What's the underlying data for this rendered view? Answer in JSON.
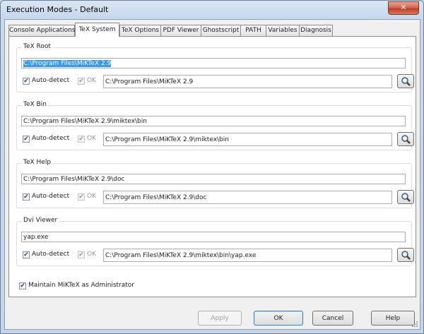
{
  "window": {
    "title": "Execution Modes - Default",
    "close_label": "✕"
  },
  "tabs": [
    {
      "label": "Console Applications"
    },
    {
      "label": "TeX System"
    },
    {
      "label": "TeX Options"
    },
    {
      "label": "PDF Viewer"
    },
    {
      "label": "Ghostscript"
    },
    {
      "label": "PATH"
    },
    {
      "label": "Variables"
    },
    {
      "label": "Diagnosis"
    }
  ],
  "active_tab": "TeX System",
  "groups": [
    {
      "label": "TeX Root",
      "value": "C:\\Program Files\\MiKTeX 2.9",
      "auto_detect_label": "Auto-detect",
      "ok_label": "OK",
      "detected_value": "C:\\Program Files\\MiKTeX 2.9"
    },
    {
      "label": "TeX Bin",
      "value": "C:\\Program Files\\MiKTeX 2.9\\miktex\\bin",
      "auto_detect_label": "Auto-detect",
      "ok_label": "OK",
      "detected_value": "C:\\Program Files\\MiKTeX 2.9\\miktex\\bin"
    },
    {
      "label": "TeX Help",
      "value": "C:\\Program Files\\MiKTeX 2.9\\doc",
      "auto_detect_label": "Auto-detect",
      "ok_label": "OK",
      "detected_value": "C:\\Program Files\\MiKTeX 2.9\\doc"
    },
    {
      "label": "Dvi Viewer",
      "value": "yap.exe",
      "auto_detect_label": "Auto-detect",
      "ok_label": "OK",
      "detected_value": "C:\\Program Files\\MiKTeX 2.9\\miktex\\bin\\yap.exe"
    }
  ],
  "admin": {
    "label": "Maintain MiKTeX as Administrator",
    "checked": true
  },
  "buttons": {
    "apply": "Apply",
    "ok": "OK",
    "cancel": "Cancel",
    "help": "Help"
  },
  "icons": {
    "browse": "magnifier-icon",
    "close": "close-icon"
  },
  "colors": {
    "selection": "#3399ff",
    "close_button": "#c13d22",
    "title_bar": "#c8d9ee"
  }
}
